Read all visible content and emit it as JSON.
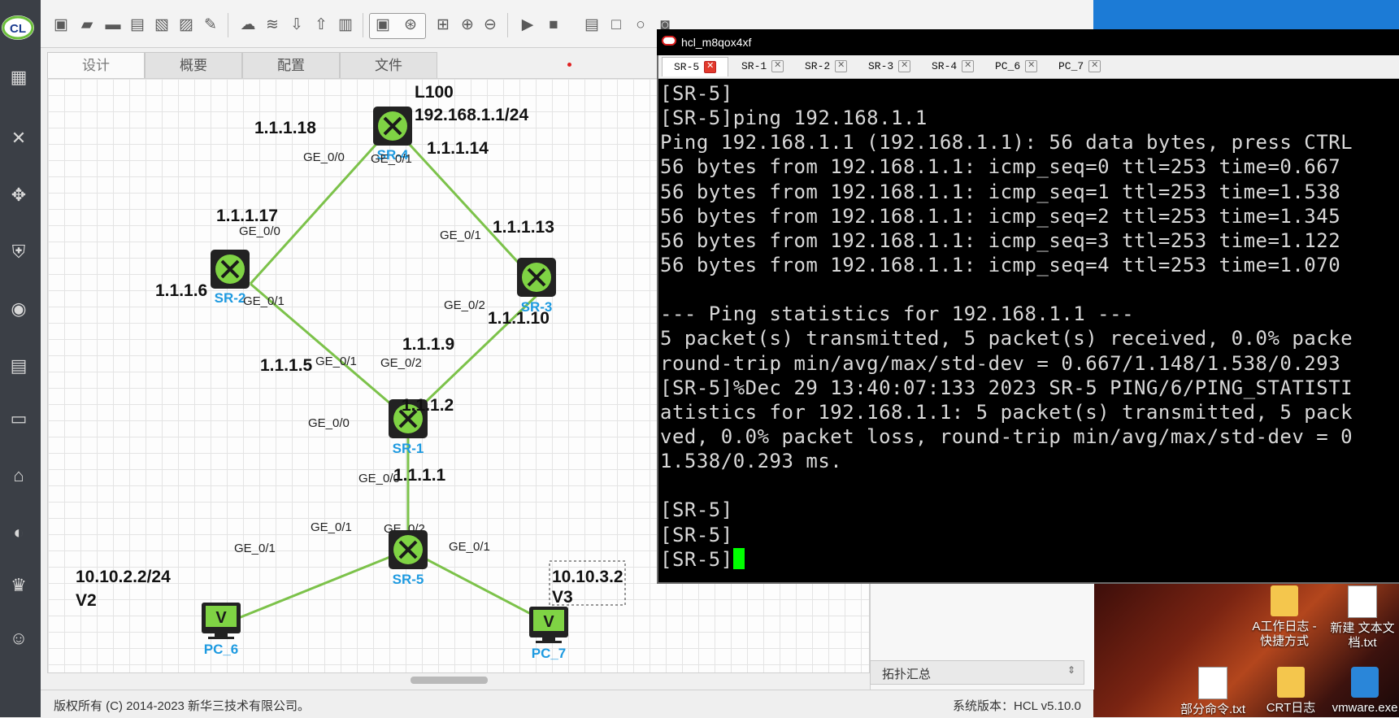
{
  "hcl": {
    "canvas_tabs": [
      "设计",
      "概要",
      "配置",
      "文件"
    ],
    "status_left": "版权所有 (C) 2014-2023 新华三技术有限公司。",
    "status_right": "系统版本：HCL v5.10.0",
    "summary_title": "拓扑汇总",
    "logo_text": "CL"
  },
  "topology": {
    "devices": [
      {
        "name": "SR-4",
        "type": "router"
      },
      {
        "name": "SR-2",
        "type": "router"
      },
      {
        "name": "SR-3",
        "type": "router"
      },
      {
        "name": "SR-1",
        "type": "router"
      },
      {
        "name": "SR-5",
        "type": "router"
      },
      {
        "name": "PC_6",
        "type": "pc"
      },
      {
        "name": "PC_7",
        "type": "pc"
      }
    ],
    "annotations": [
      "L100",
      "192.168.1.1/24",
      "1.1.1.18",
      "1.1.1.14",
      "1.1.1.17",
      "1.1.1.13",
      "1.1.1.6",
      "1.1.1.10",
      "1.1.1.9",
      "1.1.1.5",
      "1.1.1.2",
      "1.1.1.1",
      "10.10.2.2/24",
      "V2",
      "10.10.3.2",
      "V3"
    ],
    "ports": [
      "GE_0/0",
      "GE_0/1",
      "GE_0/0",
      "GE_0/1",
      "GE_0/1",
      "GE_0/2",
      "GE_0/1",
      "GE_0/2",
      "GE_0/0",
      "GE_0/0",
      "GE_0/1",
      "GE_0/2",
      "GE_0/1",
      "GE_0/1"
    ],
    "link_color": "#7cc24a"
  },
  "terminal": {
    "title": "hcl_m8qox4xf",
    "tabs": [
      "SR-5",
      "SR-1",
      "SR-2",
      "SR-3",
      "SR-4",
      "PC_6",
      "PC_7"
    ],
    "lines": [
      "[SR-5]",
      "[SR-5]ping 192.168.1.1",
      "Ping 192.168.1.1 (192.168.1.1): 56 data bytes, press CTRL",
      "56 bytes from 192.168.1.1: icmp_seq=0 ttl=253 time=0.667",
      "56 bytes from 192.168.1.1: icmp_seq=1 ttl=253 time=1.538",
      "56 bytes from 192.168.1.1: icmp_seq=2 ttl=253 time=1.345",
      "56 bytes from 192.168.1.1: icmp_seq=3 ttl=253 time=1.122",
      "56 bytes from 192.168.1.1: icmp_seq=4 ttl=253 time=1.070",
      "",
      "--- Ping statistics for 192.168.1.1 ---",
      "5 packet(s) transmitted, 5 packet(s) received, 0.0% packe",
      "round-trip min/avg/max/std-dev = 0.667/1.148/1.538/0.293",
      "[SR-5]%Dec 29 13:40:07:133 2023 SR-5 PING/6/PING_STATISTI",
      "atistics for 192.168.1.1: 5 packet(s) transmitted, 5 pack",
      "ved, 0.0% packet loss, round-trip min/avg/max/std-dev = 0",
      "1.538/0.293 ms.",
      "",
      "[SR-5]",
      "[SR-5]",
      "[SR-5]"
    ]
  },
  "desktop": {
    "icons": [
      {
        "label": "A工作日志 - 快捷方式",
        "icon": "folder-shortcut-icon"
      },
      {
        "label": "新建 文本文档.txt",
        "icon": "text-file-icon"
      },
      {
        "label": "部分命令.txt",
        "icon": "text-file-icon"
      },
      {
        "label": "CRT日志",
        "icon": "folder-icon"
      },
      {
        "label": "vmware.exe",
        "icon": "vmware-icon"
      }
    ]
  }
}
